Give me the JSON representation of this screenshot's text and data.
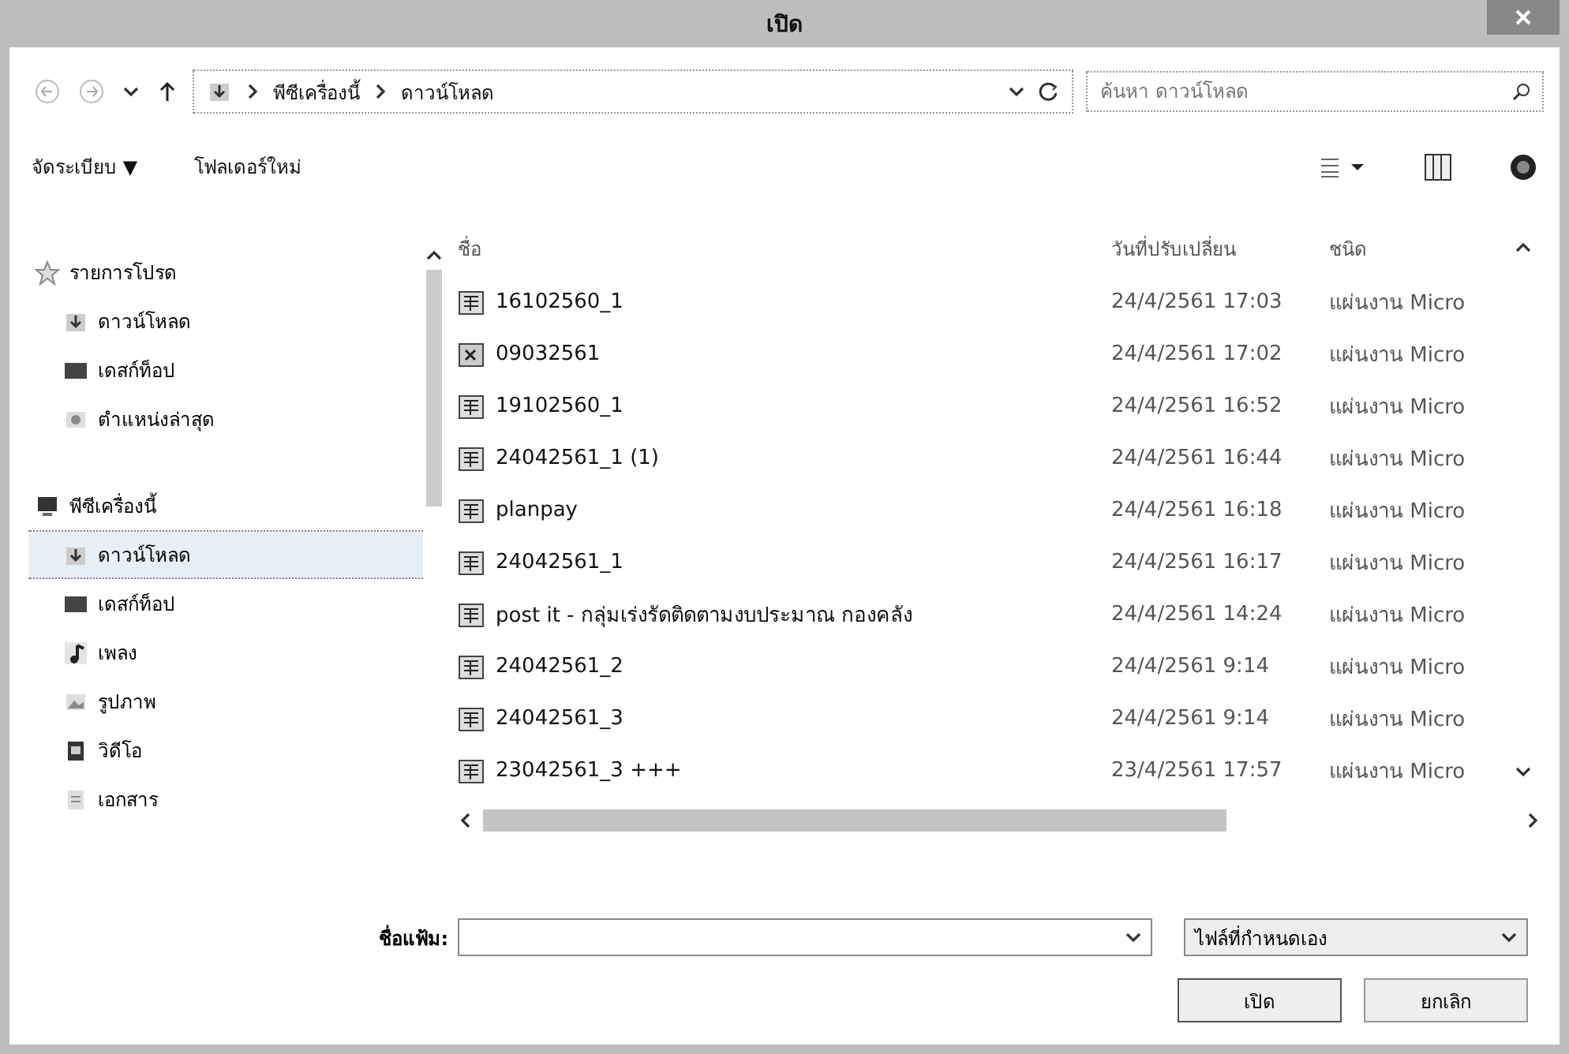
{
  "window": {
    "title": "เปิด"
  },
  "nav": {
    "breadcrumb": [
      "พีซีเครื่องนี้",
      "ดาวน์โหลด"
    ],
    "search": {
      "placeholder": "ค้นหา ดาวน์โหลด"
    }
  },
  "toolbar": {
    "organize": "จัดระเบียบ ▼",
    "new_folder": "โฟลเดอร์ใหม่"
  },
  "sidebar": {
    "items": [
      {
        "label": "รายการโปรด",
        "kind": "star",
        "selected": false,
        "children": [
          {
            "label": "ดาวน์โหลด",
            "kind": "download",
            "selected": false
          },
          {
            "label": "เดสก์ท็อป",
            "kind": "desktop",
            "selected": false
          },
          {
            "label": "ตำแหน่งล่าสุด",
            "kind": "recent",
            "selected": false
          }
        ]
      },
      {
        "label": "พีซีเครื่องนี้",
        "kind": "pc",
        "selected": false,
        "children": [
          {
            "label": "ดาวน์โหลด",
            "kind": "download",
            "selected": true
          },
          {
            "label": "เดสก์ท็อป",
            "kind": "desktop",
            "selected": false
          },
          {
            "label": "เพลง",
            "kind": "music",
            "selected": false
          },
          {
            "label": "รูปภาพ",
            "kind": "pictures",
            "selected": false
          },
          {
            "label": "วิดีโอ",
            "kind": "video",
            "selected": false
          },
          {
            "label": "เอกสาร",
            "kind": "documents",
            "selected": false
          }
        ]
      }
    ]
  },
  "table": {
    "columns": [
      "ชื่อ",
      "วันที่ปรับเปลี่ยน",
      "ชนิด"
    ],
    "rows": [
      {
        "name": "16102560_1",
        "modified": "24/4/2561 17:03",
        "type": "แผ่นงาน Micro",
        "kind": "sheet"
      },
      {
        "name": "09032561",
        "modified": "24/4/2561 17:02",
        "type": "แผ่นงาน Micro",
        "kind": "legacy"
      },
      {
        "name": "19102560_1",
        "modified": "24/4/2561 16:52",
        "type": "แผ่นงาน Micro",
        "kind": "sheet"
      },
      {
        "name": "24042561_1 (1)",
        "modified": "24/4/2561 16:44",
        "type": "แผ่นงาน Micro",
        "kind": "sheet"
      },
      {
        "name": "planpay",
        "modified": "24/4/2561 16:18",
        "type": "แผ่นงาน Micro",
        "kind": "sheet"
      },
      {
        "name": "24042561_1",
        "modified": "24/4/2561 16:17",
        "type": "แผ่นงาน Micro",
        "kind": "sheet"
      },
      {
        "name": "post it - กลุ่มเร่งรัดติดตามงบประมาณ กองคลัง",
        "modified": "24/4/2561 14:24",
        "type": "แผ่นงาน Micro",
        "kind": "sheet"
      },
      {
        "name": "24042561_2",
        "modified": "24/4/2561 9:14",
        "type": "แผ่นงาน Micro",
        "kind": "sheet"
      },
      {
        "name": "24042561_3",
        "modified": "24/4/2561 9:14",
        "type": "แผ่นงาน Micro",
        "kind": "sheet"
      },
      {
        "name": "23042561_3 +++",
        "modified": "23/4/2561 17:57",
        "type": "แผ่นงาน Micro",
        "kind": "sheet"
      }
    ]
  },
  "footer": {
    "filename_label": "ชื่อแฟ้ม:",
    "file_type": "ไฟล์ที่กำหนดเอง",
    "buttons": [
      "เปิด",
      "ยกเลิก"
    ]
  }
}
